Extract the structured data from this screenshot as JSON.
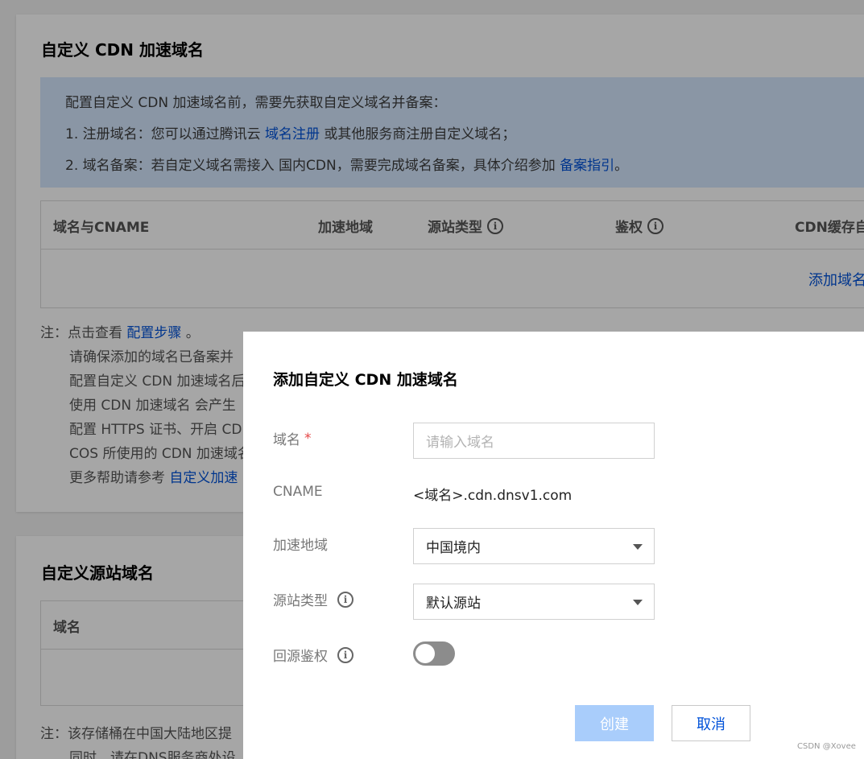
{
  "section1": {
    "title": "自定义 CDN 加速域名",
    "info": {
      "line1": "配置自定义 CDN 加速域名前，需要先获取自定义域名并备案：",
      "line2_prefix": "1. 注册域名：您可以通过腾讯云 ",
      "line2_link": "域名注册",
      "line2_suffix": " 或其他服务商注册自定义域名；",
      "line3_prefix": "2. 域名备案：若自定义域名需接入 国内CDN，需要完成域名备案，具体介绍参加 ",
      "line3_link": "备案指引",
      "line3_suffix": "。"
    },
    "table": {
      "columns": [
        "域名与CNAME",
        "加速地域",
        "源站类型",
        "鉴权",
        "CDN缓存自"
      ],
      "empty_action": "添加域名"
    },
    "notes": {
      "prefix": "注：点击查看 ",
      "link": "配置步骤",
      "suffix": " 。",
      "lines": [
        "请确保添加的域名已备案并",
        "配置自定义 CDN 加速域名后",
        "使用 CDN 加速域名 会产生",
        "配置 HTTPS 证书、开启 CD",
        "COS 所使用的 CDN 加速域名"
      ],
      "last_prefix": "更多帮助请参考 ",
      "last_link": "自定义加速"
    }
  },
  "section2": {
    "title": "自定义源站域名",
    "table": {
      "columns": [
        "域名"
      ]
    },
    "notes": [
      "注：该存储桶在中国大陆地区提",
      "同时，请在DNS服务商处设"
    ]
  },
  "modal": {
    "title": "添加自定义 CDN 加速域名",
    "fields": {
      "domain": {
        "label": "域名",
        "required_mark": "*",
        "placeholder": "请输入域名"
      },
      "cname": {
        "label": "CNAME",
        "value": "<域名>.cdn.dnsv1.com"
      },
      "region": {
        "label": "加速地域",
        "value": "中国境内"
      },
      "origin_type": {
        "label": "源站类型",
        "value": "默认源站"
      },
      "origin_auth": {
        "label": "回源鉴权",
        "enabled": false
      }
    },
    "buttons": {
      "create": "创建",
      "cancel": "取消"
    }
  },
  "icons": {
    "info": "i"
  },
  "colors": {
    "link": "#0052d9",
    "info_bg": "#d5e7fe",
    "primary_disabled": "#a9cdfb",
    "required": "#e54545"
  },
  "watermark": "CSDN @Xovee"
}
